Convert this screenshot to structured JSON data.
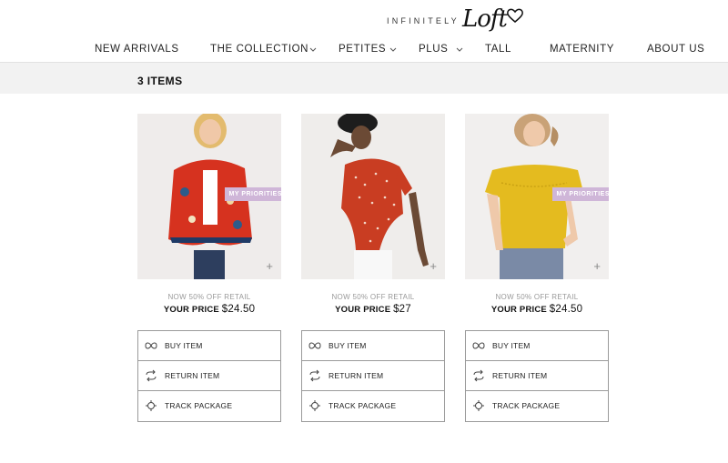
{
  "brand": {
    "tagline": "INFINITELY",
    "name": "Loft"
  },
  "nav": [
    {
      "label": "NEW ARRIVALS",
      "has_dropdown": false
    },
    {
      "label": "THE COLLECTION",
      "has_dropdown": true
    },
    {
      "label": "PETITES",
      "has_dropdown": true
    },
    {
      "label": "PLUS",
      "has_dropdown": true
    },
    {
      "label": "TALL",
      "has_dropdown": false
    },
    {
      "label": "MATERNITY",
      "has_dropdown": false
    },
    {
      "label": "ABOUT US",
      "has_dropdown": false
    }
  ],
  "items_header": "3 ITEMS",
  "items": [
    {
      "product": "red floral kimono",
      "tag": "MY PRIORITIES",
      "promo": "NOW 50% OFF RETAIL",
      "price_label": "YOUR PRICE",
      "price": "$24.50",
      "has_tag": true
    },
    {
      "product": "red polka dot wrap top",
      "tag": "",
      "promo": "NOW 50% OFF RETAIL",
      "price_label": "YOUR PRICE",
      "price": "$27",
      "has_tag": false
    },
    {
      "product": "yellow flutter sleeve top",
      "tag": "MY PRIORITIES",
      "promo": "NOW 50% OFF RETAIL",
      "price_label": "YOUR PRICE",
      "price": "$24.50",
      "has_tag": true
    }
  ],
  "actions": [
    {
      "label": "BUY ITEM",
      "icon": "infinity-icon"
    },
    {
      "label": "RETURN ITEM",
      "icon": "return-arrows-icon"
    },
    {
      "label": "TRACK PACKAGE",
      "icon": "crosshair-icon"
    }
  ],
  "colors": {
    "band": "#f2f2f2",
    "tag": "#cfb6d8",
    "border": "#9a9a9a"
  }
}
